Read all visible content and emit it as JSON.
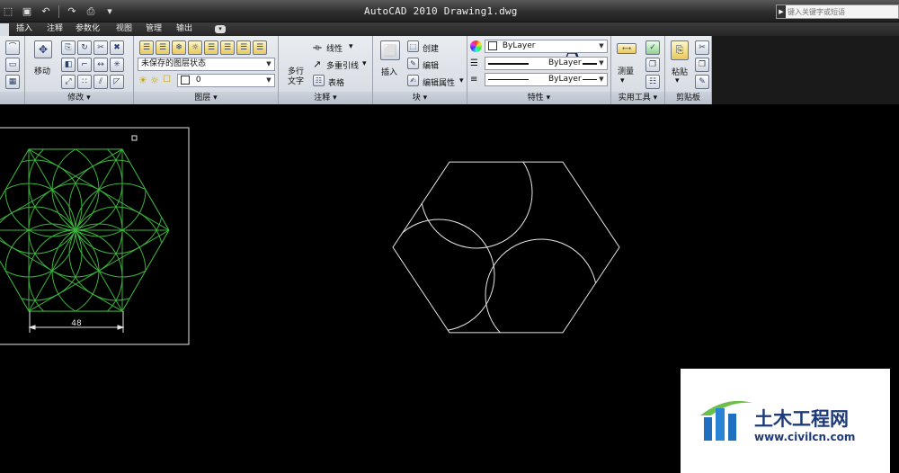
{
  "window": {
    "title": "AutoCAD 2010    Drawing1.dwg"
  },
  "quick_access": {
    "icons": [
      "open-icon",
      "save-icon",
      "undo-icon",
      "redo-icon",
      "plot-icon",
      "dropdown-icon"
    ]
  },
  "search": {
    "placeholder": "键入关键字或短语"
  },
  "tabs": [
    {
      "label": ""
    },
    {
      "label": "插入"
    },
    {
      "label": "注释"
    },
    {
      "label": "参数化"
    },
    {
      "label": "视图"
    },
    {
      "label": "管理"
    },
    {
      "label": "输出"
    }
  ],
  "ribbon": {
    "modify": {
      "title": "修改",
      "move_label": "移动"
    },
    "layers": {
      "title": "图层",
      "layer_state": "未保存的图层状态",
      "current_layer": "0"
    },
    "annotation": {
      "title": "注释",
      "mtext_label_1": "多行",
      "mtext_label_2": "文字",
      "linear_label": "线性",
      "multileader_label": "多重引线",
      "table_label": "表格"
    },
    "block": {
      "title": "块",
      "insert_label": "插入",
      "create_label": "创建",
      "edit_label": "编辑",
      "edit_attr_label": "编辑属性"
    },
    "properties": {
      "title": "特性",
      "color": "ByLayer",
      "linetype": "ByLayer",
      "lineweight": "ByLayer"
    },
    "utilities": {
      "title": "实用工具",
      "measure_label": "测量"
    },
    "clipboard": {
      "title": "剪贴板",
      "paste_label": "粘贴"
    }
  },
  "drawing": {
    "dimension_value": "48",
    "left_color": "#3cb33c",
    "right_color": "#e6e6e6",
    "frame_color": "#e6e6e6"
  },
  "watermark": {
    "brand": "土木工程网",
    "url": "www.civilcn.com"
  }
}
